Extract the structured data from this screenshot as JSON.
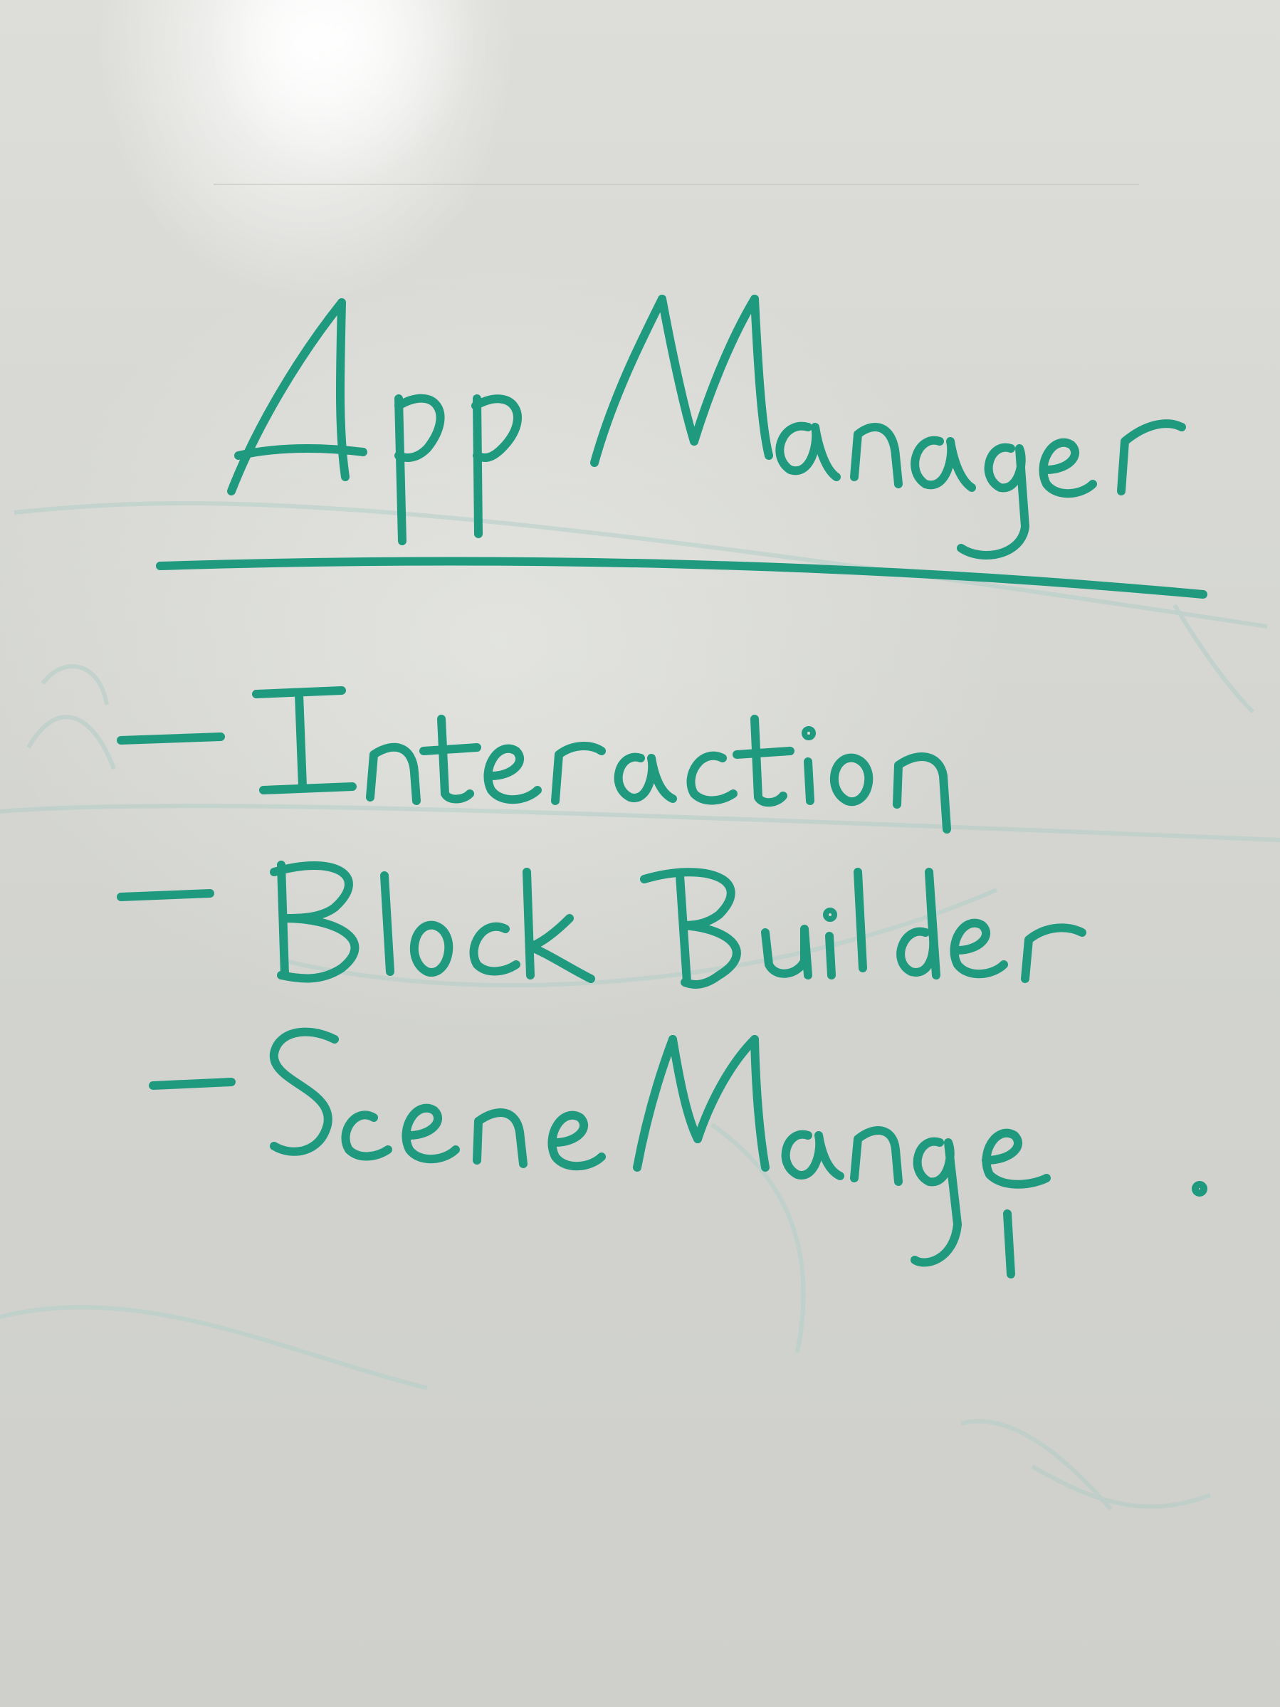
{
  "whiteboard": {
    "title": "AppManager",
    "items": [
      {
        "text": "Interaction"
      },
      {
        "text": "BlockBuilder"
      },
      {
        "text": "SceneManage."
      }
    ]
  },
  "colors": {
    "ink": "#1f9a7f",
    "ghost_ink": "#a8c7c0",
    "board": "#d7d8d4"
  }
}
